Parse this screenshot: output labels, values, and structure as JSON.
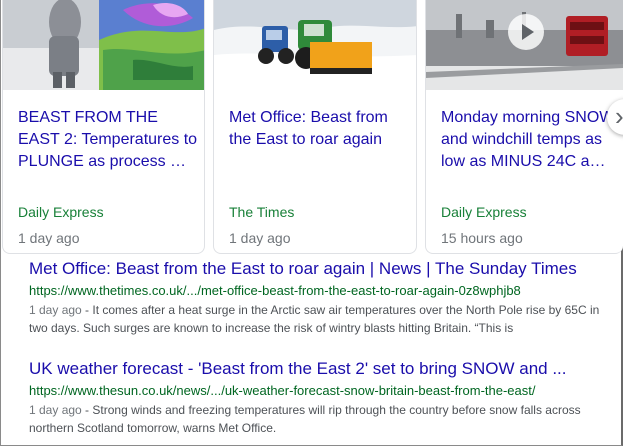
{
  "news_cards": [
    {
      "title": "BEAST FROM THE EAST 2: Temperatures to PLUNGE as process …",
      "source": "Daily Express",
      "time": "1 day ago"
    },
    {
      "title": "Met Office: Beast from the East to roar again",
      "source": "The Times",
      "time": "1 day ago"
    },
    {
      "title": "Monday morning SNOW and windchill temps as low as MINUS 24C a…",
      "source": "Daily Express",
      "time": "15 hours ago"
    }
  ],
  "results": [
    {
      "title": "Met Office: Beast from the East to roar again | News | The Sunday Times",
      "url": "https://www.thetimes.co.uk/.../met-office-beast-from-the-east-to-roar-again-0z8wphjb8",
      "date": "1 day ago",
      "snippet": " - It comes after a heat surge in the Arctic saw air temperatures over the North Pole rise by 65C in two days. Such surges are known to increase the risk of wintry blasts hitting Britain. “This is"
    },
    {
      "title": "UK weather forecast - 'Beast from the East 2' set to bring SNOW and ...",
      "url": "https://www.thesun.co.uk/news/.../uk-weather-forecast-snow-britain-beast-from-the-east/",
      "date": "1 day ago",
      "snippet": " - Strong winds and freezing temperatures will rip through the country before snow falls across northern Scotland tomorrow, warns Met Office."
    }
  ],
  "icons": {
    "play": "play-icon",
    "next": "chevron-right-icon"
  },
  "colors": {
    "link": "#1a0dab",
    "source": "#188038",
    "url": "#006621",
    "meta": "#70757a"
  }
}
